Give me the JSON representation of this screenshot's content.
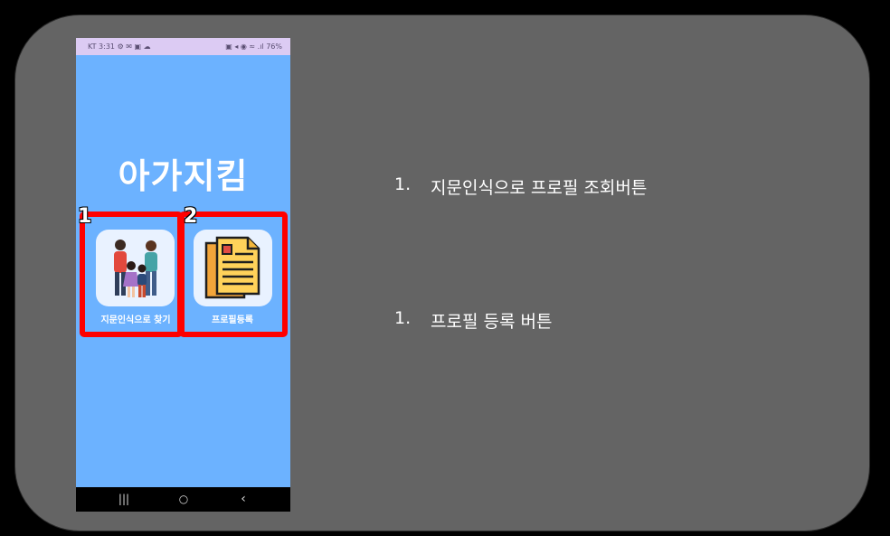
{
  "phone": {
    "status_left": "KT 3:31 ⚙ ✉ ▣ ☁",
    "status_right": "▣ ◂ ◉ ≈ .ıl 76%",
    "app_title": "아가지킴",
    "buttons": [
      {
        "label": "지문인식으로 찾기",
        "icon": "family-icon"
      },
      {
        "label": "프로필등록",
        "icon": "documents-icon"
      }
    ],
    "navbar": {
      "recent": "|||",
      "home": "○",
      "back": "‹"
    }
  },
  "annotations": {
    "marker_1": "1",
    "marker_2": "2",
    "highlight_color": "#ff0000"
  },
  "descriptions": [
    {
      "num": "1.",
      "text": "지문인식으로 프로필 조회버튼"
    },
    {
      "num": "1.",
      "text": "프로필 등록 버튼"
    }
  ]
}
